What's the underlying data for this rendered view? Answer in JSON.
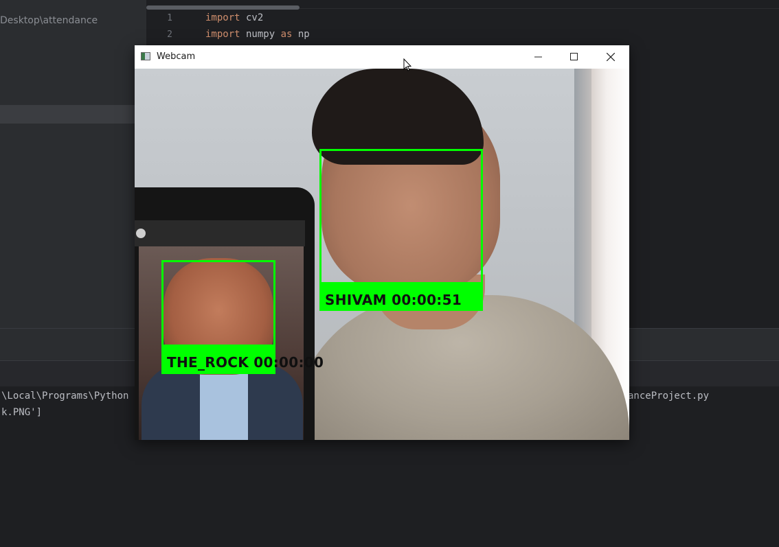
{
  "project": {
    "path": "Desktop\\attendance"
  },
  "editor": {
    "lines": [
      {
        "num": "1",
        "kw1": "import",
        "rest1": " cv2",
        "kw2": "",
        "rest2": ""
      },
      {
        "num": "2",
        "kw1": "import",
        "rest1": " numpy ",
        "kw2": "as",
        "rest2": " np"
      }
    ]
  },
  "console": {
    "line1_left": "\\Local\\Programs\\Python",
    "line1_right": "anceProject.py",
    "line2": "k.PNG']"
  },
  "webcam": {
    "title": "Webcam",
    "controls": {
      "minimize": "minimize-icon",
      "maximize": "maximize-icon",
      "close": "close-icon"
    },
    "detections": [
      {
        "name": "SHIVAM",
        "time": "00:00:51",
        "label": "SHIVAM 00:00:51"
      },
      {
        "name": "THE_ROCK",
        "time": "00:00:00",
        "label": "THE_ROCK 00:00:00"
      }
    ],
    "box_color": "#00ff00"
  }
}
